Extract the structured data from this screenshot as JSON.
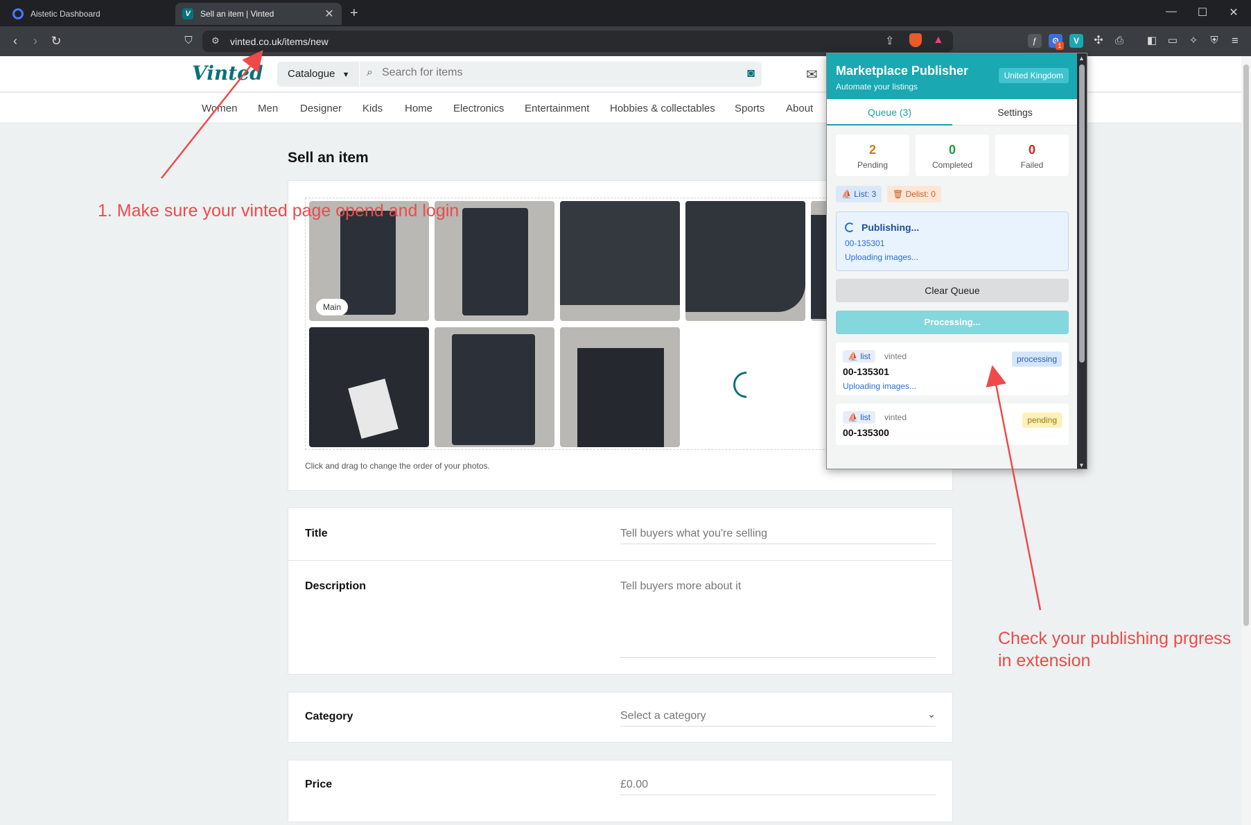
{
  "browser": {
    "tabs": [
      {
        "title": "Aistetic Dashboard",
        "active": false
      },
      {
        "title": "Sell an item | Vinted",
        "active": true
      }
    ],
    "url": "vinted.co.uk/items/new",
    "ext_badge_count": "1"
  },
  "vinted": {
    "logo": "Vinted",
    "catalogue_label": "Catalogue",
    "search_placeholder": "Search for items",
    "nav": [
      "Women",
      "Men",
      "Designer",
      "Kids",
      "Home",
      "Electronics",
      "Entertainment",
      "Hobbies & collectables",
      "Sports",
      "About"
    ],
    "page_title": "Sell an item",
    "main_badge": "Main",
    "photo_hint": "Click and drag to change the order of your photos.",
    "form": {
      "title_label": "Title",
      "title_placeholder": "Tell buyers what you're selling",
      "description_label": "Description",
      "description_placeholder": "Tell buyers more about it",
      "category_label": "Category",
      "category_placeholder": "Select a category",
      "price_label": "Price",
      "price_placeholder": "£0.00"
    }
  },
  "extension": {
    "title": "Marketplace Publisher",
    "subtitle": "Automate your listings",
    "region": "United Kingdom",
    "tabs": [
      "Queue (3)",
      "Settings"
    ],
    "stats": [
      {
        "value": "2",
        "label": "Pending",
        "color": "#c77f0c"
      },
      {
        "value": "0",
        "label": "Completed",
        "color": "#1f9a3e"
      },
      {
        "value": "0",
        "label": "Failed",
        "color": "#d62020"
      }
    ],
    "chips": {
      "list": "List: 3",
      "delist": "Delist: 0"
    },
    "publishing": {
      "title": "Publishing...",
      "id": "00-135301",
      "status": "Uploading images..."
    },
    "clear_button": "Clear Queue",
    "processing_button": "Processing...",
    "queue": [
      {
        "tag": "list",
        "platform": "vinted",
        "id": "00-135301",
        "status": "Uploading images...",
        "badge": "processing"
      },
      {
        "tag": "list",
        "platform": "vinted",
        "id": "00-135300",
        "status": "",
        "badge": "pending"
      }
    ]
  },
  "annotations": {
    "step1": "1. Make sure your vinted page opend and login",
    "step2": "Check your publishing prgress in extension",
    "color": "#ee4a4a"
  }
}
